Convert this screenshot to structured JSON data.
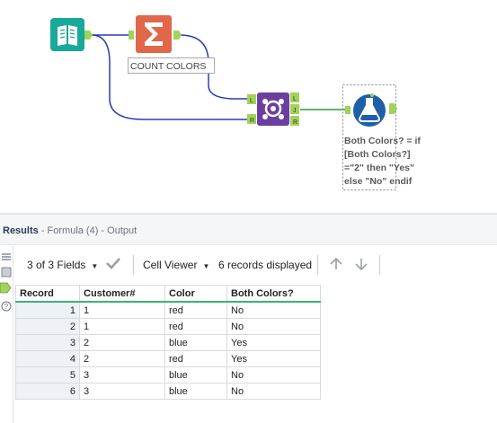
{
  "canvas": {
    "tools": {
      "input": {
        "icon": "book-input-icon"
      },
      "summarize": {
        "icon": "sigma-icon",
        "annotation": "COUNT COLORS"
      },
      "join": {
        "icon": "join-icon",
        "left_anchor": "L",
        "right_anchor": "R",
        "out_left": "L",
        "out_join": "J",
        "out_right": "R"
      },
      "formula": {
        "icon": "flask-icon",
        "annotation_lines": [
          "Both Colors? = if",
          "[Both Colors?]",
          "=\"2\" then \"Yes\"",
          "else \"No\" endif"
        ]
      }
    }
  },
  "results": {
    "title": "Results",
    "subtitle": "- Formula (4) - Output",
    "toolbar": {
      "fields_label": "3 of 3 Fields",
      "viewer_label": "Cell Viewer",
      "records_label": "6 records displayed"
    },
    "columns": [
      "Record",
      "Customer#",
      "Color",
      "Both Colors?"
    ],
    "rows": [
      [
        "1",
        "1",
        "red",
        "No"
      ],
      [
        "2",
        "1",
        "red",
        "No"
      ],
      [
        "3",
        "2",
        "blue",
        "Yes"
      ],
      [
        "4",
        "2",
        "red",
        "Yes"
      ],
      [
        "5",
        "3",
        "blue",
        "No"
      ],
      [
        "6",
        "3",
        "blue",
        "No"
      ]
    ]
  },
  "colors": {
    "input_tool": "#18a999",
    "summarize_tool": "#e2674a",
    "join_tool": "#6b3fa0",
    "formula_tool": "#1f5fa8",
    "connector_blue": "#2b3bb5",
    "connector_green": "#2e9a45",
    "header_underline": "#3cb371"
  }
}
